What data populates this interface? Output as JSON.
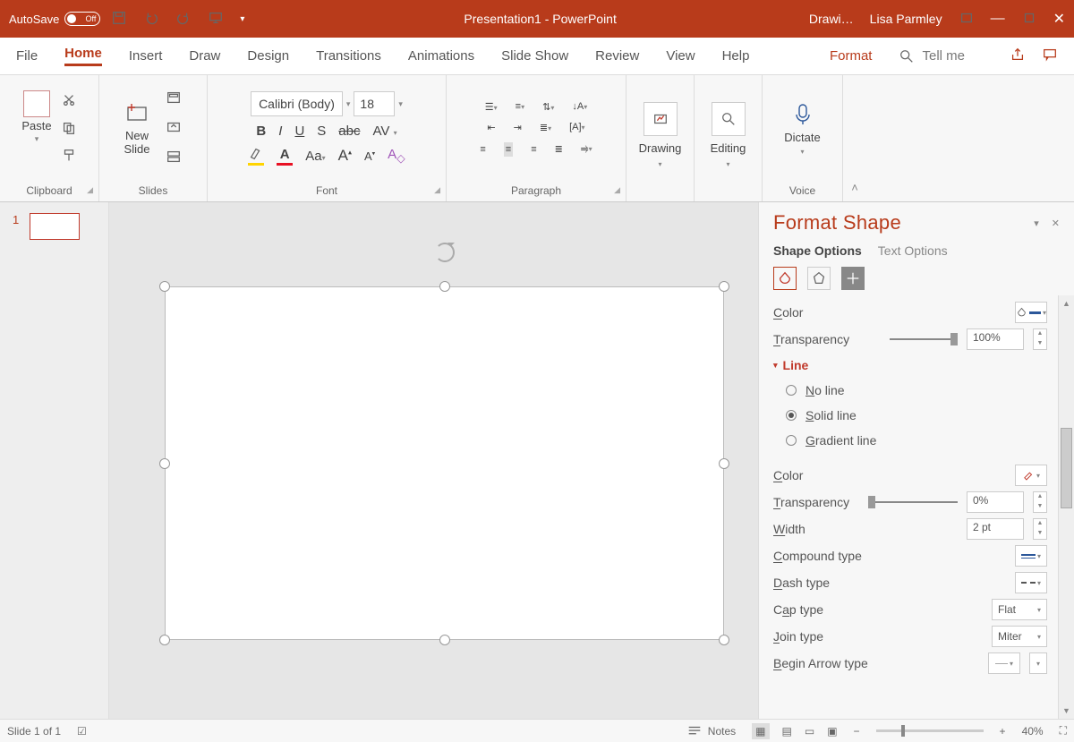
{
  "titlebar": {
    "autosave_label": "AutoSave",
    "autosave_state": "Off",
    "doc_title": "Presentation1  -  PowerPoint",
    "context_tab": "Drawi…",
    "user_name": "Lisa Parmley"
  },
  "tabs": {
    "file": "File",
    "home": "Home",
    "insert": "Insert",
    "draw": "Draw",
    "design": "Design",
    "transitions": "Transitions",
    "animations": "Animations",
    "slideshow": "Slide Show",
    "review": "Review",
    "view": "View",
    "help": "Help",
    "format": "Format",
    "tellme": "Tell me"
  },
  "ribbon": {
    "clipboard": {
      "paste": "Paste",
      "label": "Clipboard"
    },
    "slides": {
      "new_slide": "New\nSlide",
      "label": "Slides"
    },
    "font": {
      "name": "Calibri (Body)",
      "size": "18",
      "label": "Font",
      "bold": "B",
      "italic": "I",
      "underline": "U",
      "shadow": "S",
      "strike": "abc",
      "spacing": "AV",
      "case": "Aa",
      "grow": "A",
      "shrink": "A",
      "clear": "A"
    },
    "paragraph": {
      "label": "Paragraph"
    },
    "drawing": {
      "label": "Drawing"
    },
    "editing": {
      "label": "Editing"
    },
    "voice": {
      "dictate": "Dictate",
      "label": "Voice"
    }
  },
  "thumbs": {
    "n1": "1"
  },
  "pane": {
    "title": "Format Shape",
    "shape_options": "Shape Options",
    "text_options": "Text Options",
    "fill_color": "Color",
    "fill_transparency": "Transparency",
    "fill_transparency_val": "100%",
    "line_header": "Line",
    "no_line": "No line",
    "solid_line": "Solid line",
    "gradient_line": "Gradient line",
    "line_color": "Color",
    "line_transparency": "Transparency",
    "line_transparency_val": "0%",
    "width_lbl": "Width",
    "width_val": "2 pt",
    "compound": "Compound type",
    "dash": "Dash type",
    "cap": "Cap type",
    "cap_val": "Flat",
    "join": "Join type",
    "join_val": "Miter",
    "begin_arrow": "Begin Arrow type"
  },
  "status": {
    "slide": "Slide 1 of 1",
    "notes": "Notes",
    "zoom": "40%"
  }
}
